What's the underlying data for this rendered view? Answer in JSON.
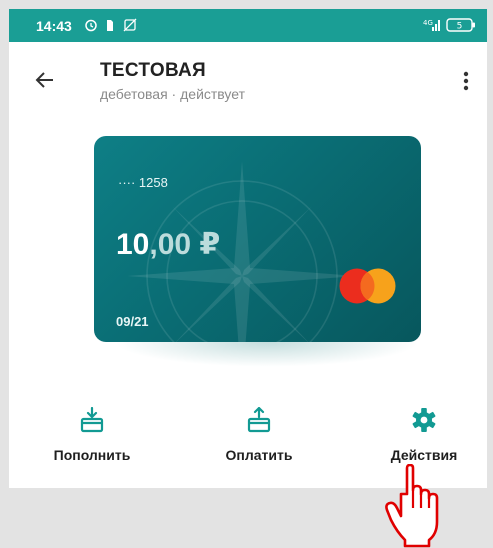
{
  "status_bar": {
    "time": "14:43",
    "battery": "5"
  },
  "header": {
    "title": "ТЕСТОВАЯ",
    "subtitle": "дебетовая · действует"
  },
  "card": {
    "masked_number": "···· 1258",
    "balance_int": "10",
    "balance_dec": ",00 ₽",
    "expiry": "09/21",
    "brand_icon": "mastercard-logo"
  },
  "actions": [
    {
      "label": "Пополнить",
      "icon": "top-up-icon"
    },
    {
      "label": "Оплатить",
      "icon": "pay-icon"
    },
    {
      "label": "Действия",
      "icon": "gear-icon"
    }
  ],
  "colors": {
    "status_bar": "#1a9e95",
    "accent": "#129a93",
    "card_dark": "#07575d",
    "cursor": "#e00000"
  }
}
